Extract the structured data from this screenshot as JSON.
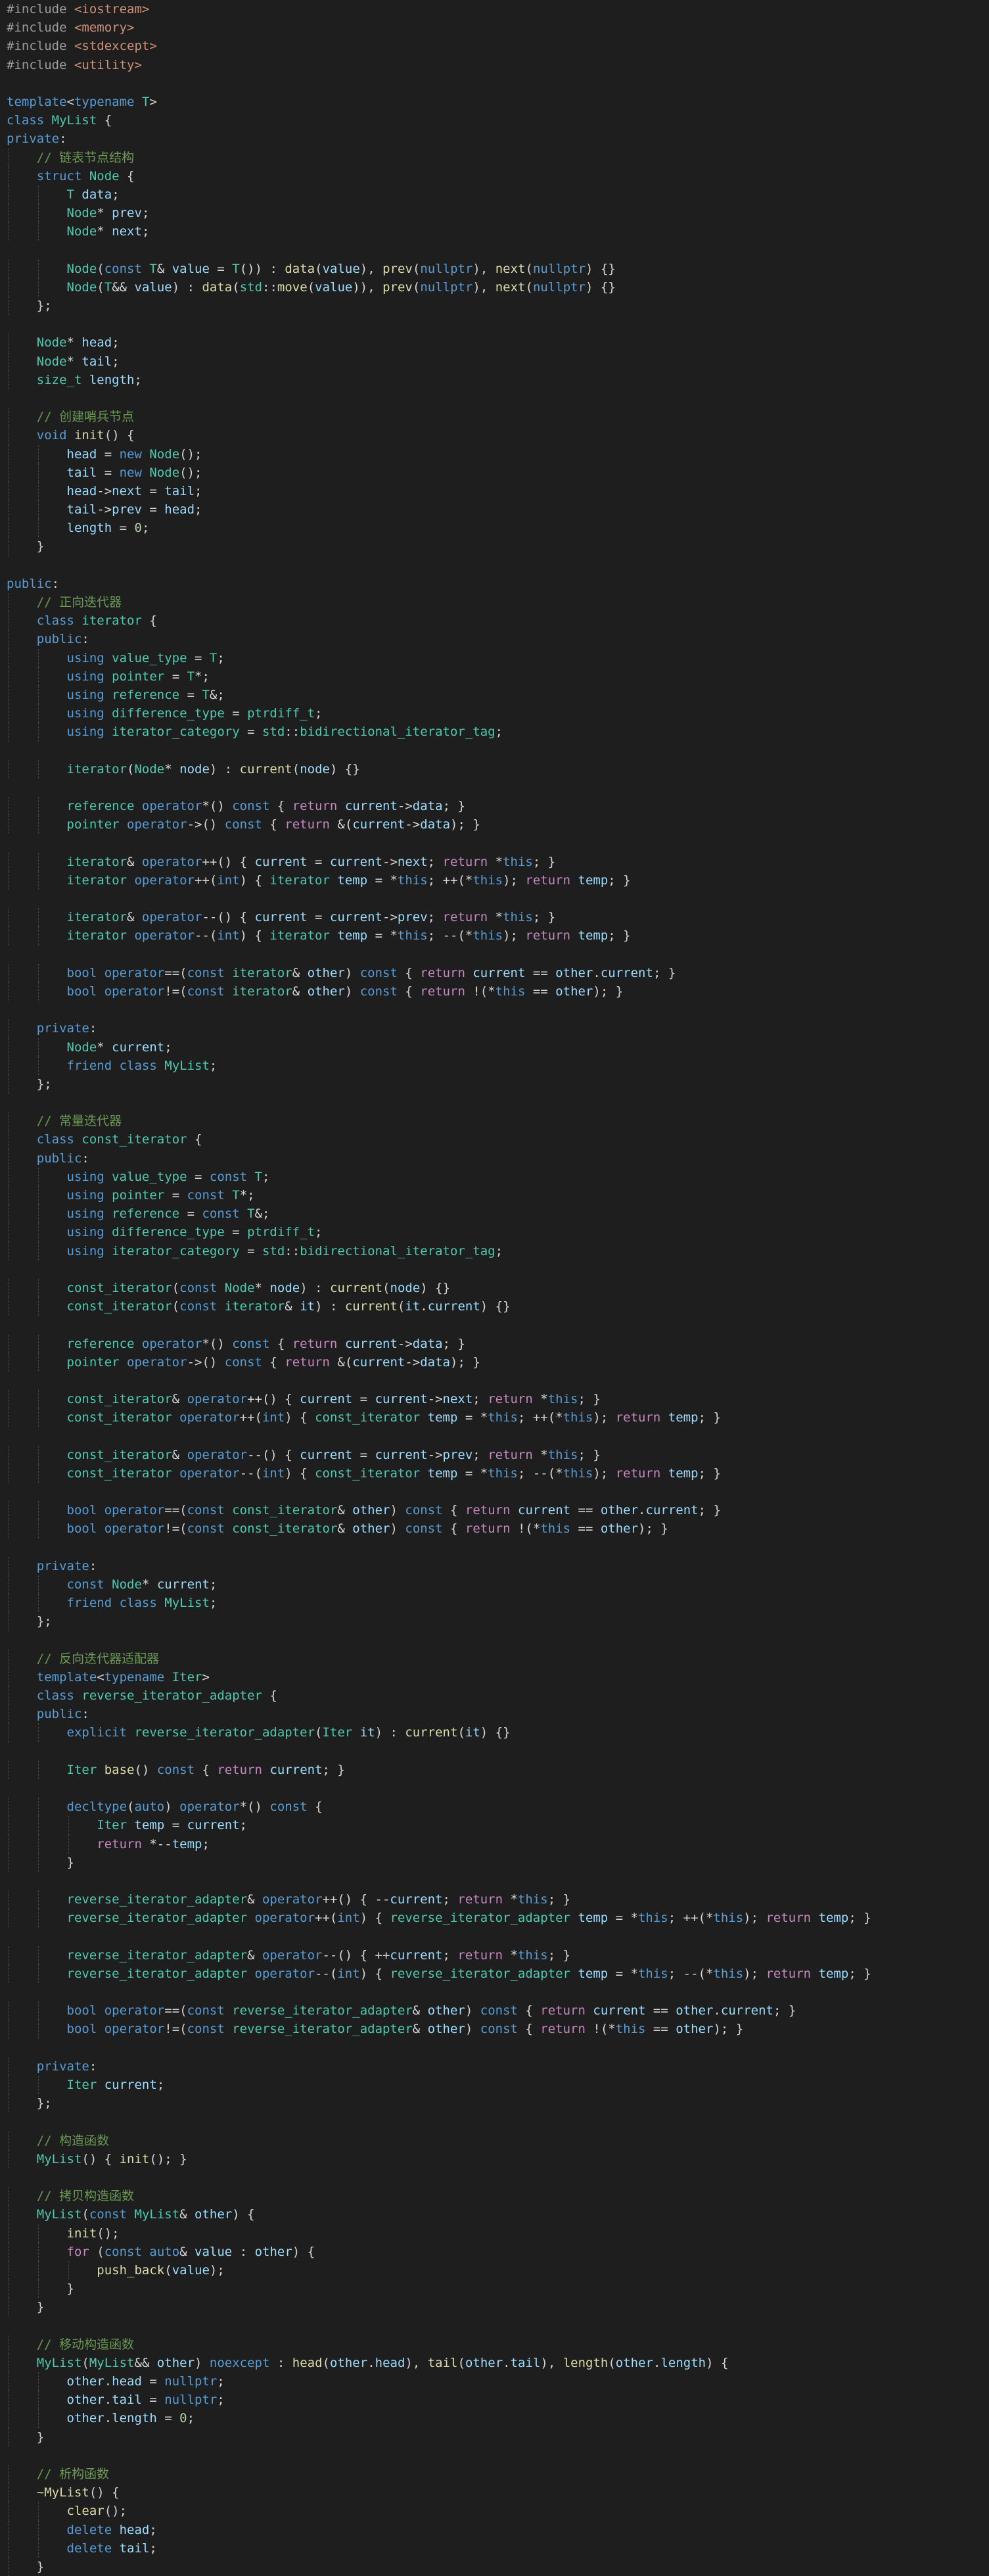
{
  "editor": {
    "language": "cpp",
    "colors": {
      "background": "#1e1e1e",
      "keyword": "#569cd6",
      "control": "#c586c0",
      "type": "#4ec9b0",
      "function": "#dcdcaa",
      "variable": "#9cdcfe",
      "number": "#b5cea8",
      "comment": "#6a9955",
      "include": "#ce9178"
    },
    "lines": [
      "#include <iostream>",
      "#include <memory>",
      "#include <stdexcept>",
      "#include <utility>",
      "",
      "template<typename T>",
      "class MyList {",
      "private:",
      "    // 链表节点结构",
      "    struct Node {",
      "        T data;",
      "        Node* prev;",
      "        Node* next;",
      "",
      "        Node(const T& value = T()) : data(value), prev(nullptr), next(nullptr) {}",
      "        Node(T&& value) : data(std::move(value)), prev(nullptr), next(nullptr) {}",
      "    };",
      "",
      "    Node* head;",
      "    Node* tail;",
      "    size_t length;",
      "",
      "    // 创建哨兵节点",
      "    void init() {",
      "        head = new Node();",
      "        tail = new Node();",
      "        head->next = tail;",
      "        tail->prev = head;",
      "        length = 0;",
      "    }",
      "",
      "public:",
      "    // 正向迭代器",
      "    class iterator {",
      "    public:",
      "        using value_type = T;",
      "        using pointer = T*;",
      "        using reference = T&;",
      "        using difference_type = ptrdiff_t;",
      "        using iterator_category = std::bidirectional_iterator_tag;",
      "",
      "        iterator(Node* node) : current(node) {}",
      "",
      "        reference operator*() const { return current->data; }",
      "        pointer operator->() const { return &(current->data); }",
      "",
      "        iterator& operator++() { current = current->next; return *this; }",
      "        iterator operator++(int) { iterator temp = *this; ++(*this); return temp; }",
      "",
      "        iterator& operator--() { current = current->prev; return *this; }",
      "        iterator operator--(int) { iterator temp = *this; --(*this); return temp; }",
      "",
      "        bool operator==(const iterator& other) const { return current == other.current; }",
      "        bool operator!=(const iterator& other) const { return !(*this == other); }",
      "",
      "    private:",
      "        Node* current;",
      "        friend class MyList;",
      "    };",
      "",
      "    // 常量迭代器",
      "    class const_iterator {",
      "    public:",
      "        using value_type = const T;",
      "        using pointer = const T*;",
      "        using reference = const T&;",
      "        using difference_type = ptrdiff_t;",
      "        using iterator_category = std::bidirectional_iterator_tag;",
      "",
      "        const_iterator(const Node* node) : current(node) {}",
      "        const_iterator(const iterator& it) : current(it.current) {}",
      "",
      "        reference operator*() const { return current->data; }",
      "        pointer operator->() const { return &(current->data); }",
      "",
      "        const_iterator& operator++() { current = current->next; return *this; }",
      "        const_iterator operator++(int) { const_iterator temp = *this; ++(*this); return temp; }",
      "",
      "        const_iterator& operator--() { current = current->prev; return *this; }",
      "        const_iterator operator--(int) { const_iterator temp = *this; --(*this); return temp; }",
      "",
      "        bool operator==(const const_iterator& other) const { return current == other.current; }",
      "        bool operator!=(const const_iterator& other) const { return !(*this == other); }",
      "",
      "    private:",
      "        const Node* current;",
      "        friend class MyList;",
      "    };",
      "",
      "    // 反向迭代器适配器",
      "    template<typename Iter>",
      "    class reverse_iterator_adapter {",
      "    public:",
      "        explicit reverse_iterator_adapter(Iter it) : current(it) {}",
      "",
      "        Iter base() const { return current; }",
      "",
      "        decltype(auto) operator*() const {",
      "            Iter temp = current;",
      "            return *--temp;",
      "        }",
      "",
      "        reverse_iterator_adapter& operator++() { --current; return *this; }",
      "        reverse_iterator_adapter operator++(int) { reverse_iterator_adapter temp = *this; ++(*this); return temp; }",
      "",
      "        reverse_iterator_adapter& operator--() { ++current; return *this; }",
      "        reverse_iterator_adapter operator--(int) { reverse_iterator_adapter temp = *this; --(*this); return temp; }",
      "",
      "        bool operator==(const reverse_iterator_adapter& other) const { return current == other.current; }",
      "        bool operator!=(const reverse_iterator_adapter& other) const { return !(*this == other); }",
      "",
      "    private:",
      "        Iter current;",
      "    };",
      "",
      "    // 构造函数",
      "    MyList() { init(); }",
      "",
      "    // 拷贝构造函数",
      "    MyList(const MyList& other) {",
      "        init();",
      "        for (const auto& value : other) {",
      "            push_back(value);",
      "        }",
      "    }",
      "",
      "    // 移动构造函数",
      "    MyList(MyList&& other) noexcept : head(other.head), tail(other.tail), length(other.length) {",
      "        other.head = nullptr;",
      "        other.tail = nullptr;",
      "        other.length = 0;",
      "    }",
      "",
      "    // 析构函数",
      "    ~MyList() {",
      "        clear();",
      "        delete head;",
      "        delete tail;",
      "    }"
    ]
  }
}
